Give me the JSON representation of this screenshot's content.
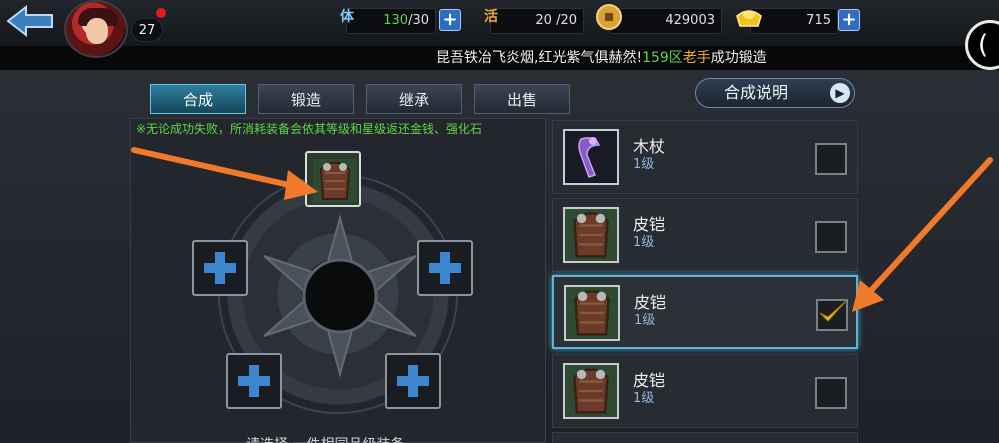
{
  "player": {
    "level": "27"
  },
  "resources": {
    "stamina": {
      "icon_label": "体",
      "value": "130",
      "max": "/30"
    },
    "energy": {
      "icon_label": "活",
      "value": "20 /20"
    },
    "coins": {
      "value": "429003"
    },
    "gold": {
      "value": "715"
    }
  },
  "marquee": {
    "prefix": "昆吾铁冶飞炎烟,红光紫气俱赫然!",
    "server": "159区",
    "player_name": "老手",
    "suffix": "成功锻造"
  },
  "tabs": [
    {
      "label": "合成"
    },
    {
      "label": "锻造"
    },
    {
      "label": "继承"
    },
    {
      "label": "出售"
    }
  ],
  "note": "※无论成功失败，所消耗装备会依其等级和星级返还金钱、强化石",
  "help_button": "合成说明",
  "bottom_hint": "请选择 一件相同品级装备",
  "items": [
    {
      "name": "木杖",
      "level": "1级",
      "checked": false
    },
    {
      "name": "皮铠",
      "level": "1级",
      "checked": false
    },
    {
      "name": "皮铠",
      "level": "1级",
      "checked": true
    },
    {
      "name": "皮铠",
      "level": "1级",
      "checked": false
    }
  ],
  "colors": {
    "accent": "#5fb4d6",
    "note_green": "#5fd648",
    "check_gold": "#f2c21c",
    "arrow_orange": "#f07a2a"
  }
}
